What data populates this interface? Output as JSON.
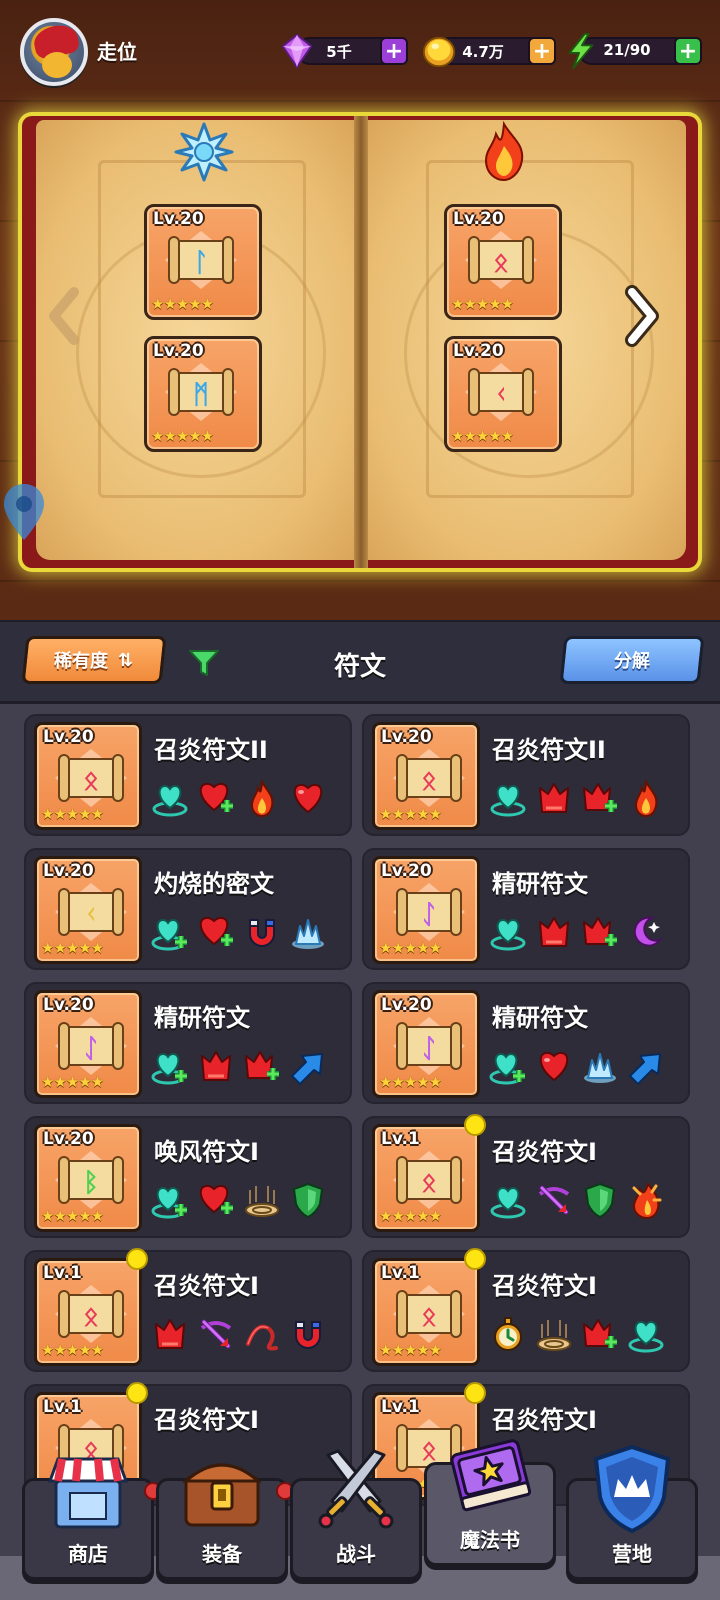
{
  "player": {
    "name": "走位"
  },
  "resources": {
    "gems": {
      "value": "5千",
      "plus": "+"
    },
    "gold": {
      "value": "4.7万",
      "plus": "+"
    },
    "energy": {
      "value": "21/90",
      "plus": "+"
    }
  },
  "book": {
    "left_element": "ice",
    "right_element": "fire",
    "slots": [
      {
        "level": "Lv.20",
        "stars": "★★★★★",
        "glyph": "ᛚ",
        "glyph_color": "#3aa8e8"
      },
      {
        "level": "Lv.20",
        "stars": "★★★★★",
        "glyph": "ᛗ",
        "glyph_color": "#3aa8e8"
      },
      {
        "level": "Lv.20",
        "stars": "★★★★★",
        "glyph": "ᛟ",
        "glyph_color": "#e83a5a"
      },
      {
        "level": "Lv.20",
        "stars": "★★★★★",
        "glyph": "ᚲ",
        "glyph_color": "#e83a5a"
      }
    ]
  },
  "toolbar": {
    "sort_label": "稀有度",
    "sort_icon": "⇅",
    "title": "符文",
    "decompose_label": "分解"
  },
  "runes": [
    {
      "level": "Lv.20",
      "stars": "★★★★★",
      "name": "召炎符文II",
      "glyph": "ᛟ",
      "glyph_color": "#e83a5a",
      "is_new": false,
      "attrs": [
        "heal-ring",
        "heart-plus",
        "flame",
        "heart"
      ]
    },
    {
      "level": "Lv.20",
      "stars": "★★★★★",
      "name": "召炎符文II",
      "glyph": "ᛟ",
      "glyph_color": "#e83a5a",
      "is_new": false,
      "attrs": [
        "heal-ring",
        "attack",
        "attack-plus",
        "flame"
      ]
    },
    {
      "level": "Lv.20",
      "stars": "★★★★★",
      "name": "灼烧的密文",
      "glyph": "ᚲ",
      "glyph_color": "#e8c040",
      "is_new": false,
      "attrs": [
        "heal-plus",
        "heart-plus",
        "magnet",
        "frost"
      ]
    },
    {
      "level": "Lv.20",
      "stars": "★★★★★",
      "name": "精研符文",
      "glyph": "ᛇ",
      "glyph_color": "#c060e8",
      "is_new": false,
      "attrs": [
        "heal-ring",
        "attack",
        "attack-plus",
        "moon"
      ]
    },
    {
      "level": "Lv.20",
      "stars": "★★★★★",
      "name": "精研符文",
      "glyph": "ᛇ",
      "glyph_color": "#c060e8",
      "is_new": false,
      "attrs": [
        "heal-plus",
        "attack",
        "attack-plus",
        "arrow"
      ]
    },
    {
      "level": "Lv.20",
      "stars": "★★★★★",
      "name": "精研符文",
      "glyph": "ᛇ",
      "glyph_color": "#c060e8",
      "is_new": false,
      "attrs": [
        "heal-plus",
        "heart",
        "frost",
        "arrow"
      ]
    },
    {
      "level": "Lv.20",
      "stars": "★★★★★",
      "name": "唤风符文I",
      "glyph": "ᛒ",
      "glyph_color": "#50d050",
      "is_new": false,
      "attrs": [
        "heal-plus",
        "heart-plus",
        "aura",
        "shield"
      ]
    },
    {
      "level": "Lv.1",
      "stars": "★★★★★",
      "name": "召炎符文I",
      "glyph": "ᛟ",
      "glyph_color": "#e83a5a",
      "is_new": true,
      "attrs": [
        "heal-ring",
        "crossbow",
        "shield",
        "flame-burst"
      ]
    },
    {
      "level": "Lv.1",
      "stars": "★★★★★",
      "name": "召炎符文I",
      "glyph": "ᛟ",
      "glyph_color": "#e83a5a",
      "is_new": true,
      "attrs": [
        "attack",
        "crossbow",
        "whip",
        "magnet"
      ]
    },
    {
      "level": "Lv.1",
      "stars": "★★★★★",
      "name": "召炎符文I",
      "glyph": "ᛟ",
      "glyph_color": "#e83a5a",
      "is_new": true,
      "attrs": [
        "stopwatch",
        "aura",
        "attack-plus",
        "heal-ring"
      ]
    },
    {
      "level": "Lv.1",
      "stars": "★★★★★",
      "name": "召炎符文I",
      "glyph": "ᛟ",
      "glyph_color": "#e83a5a",
      "is_new": true,
      "attrs": []
    },
    {
      "level": "Lv.1",
      "stars": "★★★★★",
      "name": "召炎符文I",
      "glyph": "ᛟ",
      "glyph_color": "#e83a5a",
      "is_new": true,
      "attrs": []
    }
  ],
  "nav": [
    {
      "label": "商店",
      "icon": "shop-icon",
      "active": false
    },
    {
      "label": "装备",
      "icon": "chest-icon",
      "active": false
    },
    {
      "label": "战斗",
      "icon": "swords-icon",
      "active": false
    },
    {
      "label": "魔法书",
      "icon": "spellbook-icon",
      "active": true
    },
    {
      "label": "营地",
      "icon": "crown-shield-icon",
      "active": false
    }
  ]
}
